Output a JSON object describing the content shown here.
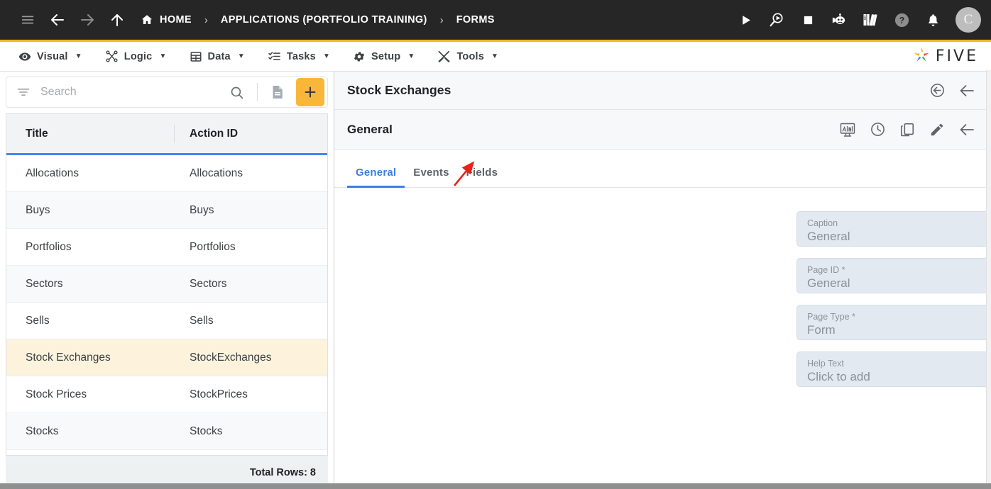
{
  "topbar": {
    "nav_icons": [
      {
        "name": "menu-icon",
        "label": "Menu"
      },
      {
        "name": "back-icon",
        "label": "Back"
      },
      {
        "name": "forward-icon",
        "label": "Forward"
      },
      {
        "name": "up-icon",
        "label": "Up"
      }
    ],
    "breadcrumbs": [
      {
        "label": "HOME",
        "icon": "home-icon"
      },
      {
        "label": "APPLICATIONS (PORTFOLIO TRAINING)",
        "icon": ""
      },
      {
        "label": "FORMS",
        "icon": ""
      }
    ],
    "separator": "›",
    "actions": [
      {
        "name": "run-icon",
        "label": "Run"
      },
      {
        "name": "debug-icon",
        "label": "Debug"
      },
      {
        "name": "stop-icon",
        "label": "Stop"
      },
      {
        "name": "chatbot-icon",
        "label": "Assistant"
      },
      {
        "name": "library-icon",
        "label": "Documentation"
      },
      {
        "name": "help-icon",
        "label": "Help"
      },
      {
        "name": "notifications-icon",
        "label": "Notifications"
      }
    ],
    "avatar_initial": "C"
  },
  "menubar": {
    "items": [
      {
        "label": "Visual",
        "icon": "eye-icon",
        "caret": "▼"
      },
      {
        "label": "Logic",
        "icon": "logic-nodes-icon",
        "caret": "▼"
      },
      {
        "label": "Data",
        "icon": "table-icon",
        "caret": "▼"
      },
      {
        "label": "Tasks",
        "icon": "checklist-icon",
        "caret": "▼"
      },
      {
        "label": "Setup",
        "icon": "gear-icon",
        "caret": "▼"
      },
      {
        "label": "Tools",
        "icon": "tools-icon",
        "caret": "▼"
      }
    ],
    "brand": "FIVE",
    "accent_color": "#f5b324"
  },
  "sidebar": {
    "search": {
      "placeholder": "Search",
      "value": ""
    },
    "toolbar": [
      {
        "name": "filter-icon",
        "label": "Filter"
      },
      {
        "name": "search-icon",
        "label": "Search"
      },
      {
        "name": "document-icon",
        "label": "Report"
      },
      {
        "name": "add-icon",
        "label": "+"
      }
    ],
    "grid": {
      "columns": [
        "Title",
        "Action ID"
      ],
      "rows": [
        {
          "title": "Allocations",
          "action_id": "Allocations",
          "selected": false
        },
        {
          "title": "Buys",
          "action_id": "Buys",
          "selected": false
        },
        {
          "title": "Portfolios",
          "action_id": "Portfolios",
          "selected": false
        },
        {
          "title": "Sectors",
          "action_id": "Sectors",
          "selected": false
        },
        {
          "title": "Sells",
          "action_id": "Sells",
          "selected": false
        },
        {
          "title": "Stock Exchanges",
          "action_id": "StockExchanges",
          "selected": true
        },
        {
          "title": "Stock Prices",
          "action_id": "StockPrices",
          "selected": false
        },
        {
          "title": "Stocks",
          "action_id": "Stocks",
          "selected": false
        }
      ],
      "footer": "Total Rows: 8",
      "header_underline_color": "#4285f4",
      "selected_row_color": "#fdf3dd"
    }
  },
  "detail": {
    "record_title": "Stock Exchanges",
    "record_actions": [
      {
        "name": "revert-icon",
        "label": "Revert"
      },
      {
        "name": "close-icon",
        "label": "Close"
      }
    ],
    "page_title": "General",
    "page_actions": [
      {
        "name": "display-preview-icon",
        "label": "Preview"
      },
      {
        "name": "history-icon",
        "label": "History"
      },
      {
        "name": "duplicate-icon",
        "label": "Duplicate"
      },
      {
        "name": "edit-icon",
        "label": "Edit"
      },
      {
        "name": "back-icon",
        "label": "Back"
      }
    ],
    "tabs": [
      {
        "label": "General",
        "active": true
      },
      {
        "label": "Events",
        "active": false
      },
      {
        "label": "Fields",
        "active": false
      }
    ],
    "active_tab_color": "#3d7fe0",
    "fields": [
      {
        "label": "Caption",
        "value": "General",
        "type": "text"
      },
      {
        "label": "Page ID *",
        "value": "General",
        "type": "text"
      },
      {
        "label": "Page Type *",
        "value": "Form",
        "type": "select"
      },
      {
        "label": "Help Text",
        "value": "Click to add",
        "type": "text"
      }
    ]
  },
  "annotation": {
    "type": "arrow",
    "color": "#e8221a",
    "points_to": "Fields"
  }
}
